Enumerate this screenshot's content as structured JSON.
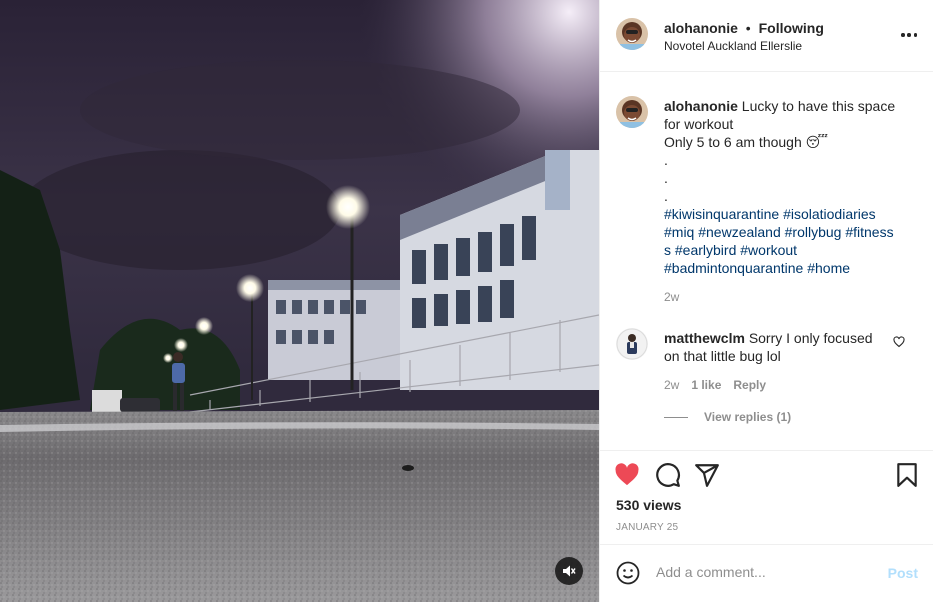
{
  "post": {
    "author": "alohanonie",
    "follow_state": "Following",
    "separator": "•",
    "location": "Novotel Auckland Ellerslie"
  },
  "caption": {
    "author": "alohanonie",
    "lines": [
      "Lucky to have this space",
      "for workout",
      "Only 5 to 6 am though 😴",
      ".",
      ".",
      "."
    ],
    "hashtags": [
      "#kiwisinquarantine #isolatiodiaries",
      "#miq #newzealand #rollybug #fitness",
      "s #earlybird #workout",
      "#badmintonquarantine #home"
    ],
    "time": "2w"
  },
  "comment": {
    "author": "matthewclm",
    "text_line1": "Sorry I only focused",
    "text_line2": "on that little bug lol",
    "time": "2w",
    "likes": "1 like",
    "reply_label": "Reply",
    "view_replies": "View replies (1)"
  },
  "actions": {
    "views": "530 views",
    "date": "JANUARY 25",
    "liked": true,
    "like_color": "#ed4956"
  },
  "add_comment": {
    "placeholder": "Add a comment...",
    "post_label": "Post"
  },
  "icons": {
    "more": "more-options-icon",
    "like": "heart-icon",
    "comment": "comment-icon",
    "share": "share-icon",
    "save": "bookmark-icon",
    "emoji": "emoji-icon",
    "mute": "volume-muted-icon"
  }
}
